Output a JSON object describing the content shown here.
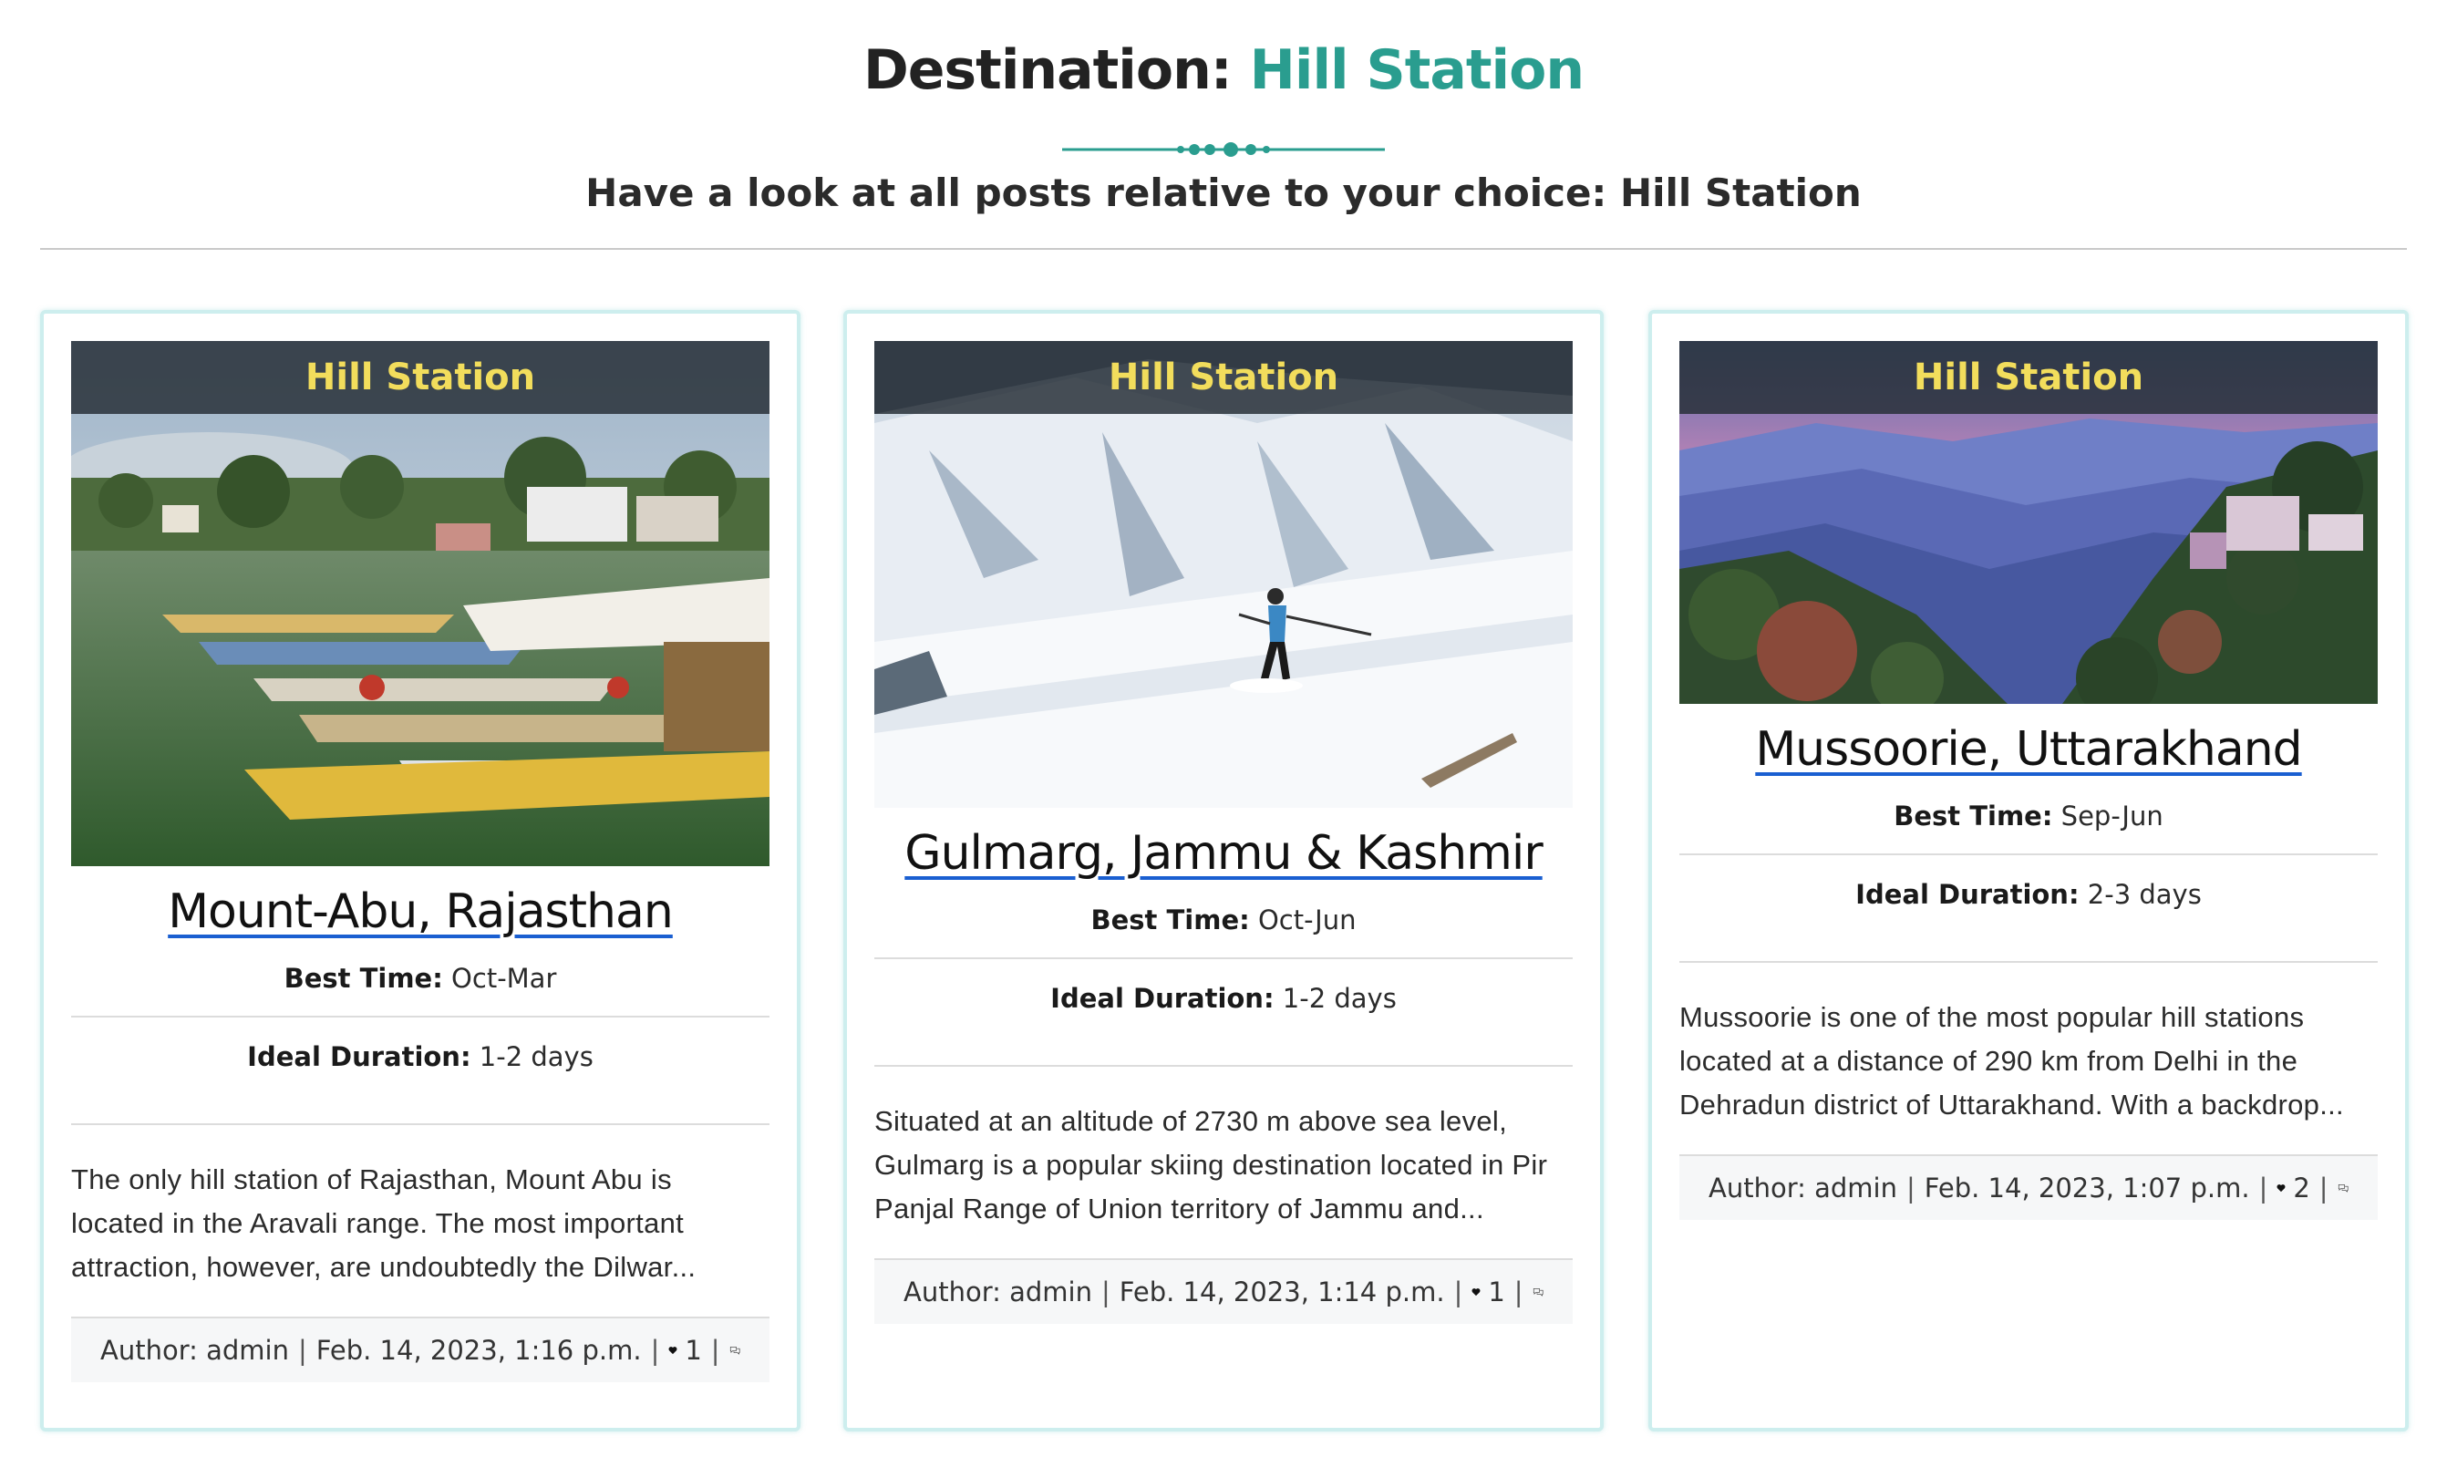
{
  "header": {
    "title_prefix": "Destination:",
    "title_accent": "Hill Station",
    "subtitle": "Have a look at all posts relative to your choice: Hill Station"
  },
  "colors": {
    "accent": "#2a9d8f",
    "banner_text": "#f2dd5c",
    "link_underline": "#1a5fd1"
  },
  "cards": [
    {
      "category": "Hill Station",
      "title": "Mount-Abu, Rajasthan",
      "best_time_label": "Best Time:",
      "best_time": "Oct-Mar",
      "duration_label": "Ideal Duration:",
      "duration": "1-2 days",
      "excerpt": "The only hill station of Rajasthan, Mount Abu is located in the Aravali range. The most important attraction, however, are undoubtedly the Dilwar...",
      "author": "Author: admin",
      "date": "Feb. 14, 2023, 1:16 p.m.",
      "likes": "1",
      "image": "lake-boats-image"
    },
    {
      "category": "Hill Station",
      "title": "Gulmarg, Jammu & Kashmir",
      "best_time_label": "Best Time:",
      "best_time": "Oct-Jun",
      "duration_label": "Ideal Duration:",
      "duration": "1-2 days",
      "excerpt": "Situated at an altitude of 2730 m above sea level, Gulmarg is a popular skiing destination located in Pir Panjal Range of Union territory of Jammu and...",
      "author": "Author: admin",
      "date": "Feb. 14, 2023, 1:14 p.m.",
      "likes": "1",
      "image": "snow-skier-image"
    },
    {
      "category": "Hill Station",
      "title": "Mussoorie, Uttarakhand",
      "best_time_label": "Best Time:",
      "best_time": "Sep-Jun",
      "duration_label": "Ideal Duration:",
      "duration": "2-3 days",
      "excerpt": "Mussoorie is one of the most popular hill stations located at a distance of 290 km from Delhi in the Dehradun district of Uttarakhand. With a backdrop...",
      "author": "Author: admin",
      "date": "Feb. 14, 2023, 1:07 p.m.",
      "likes": "2",
      "image": "mountain-valley-image"
    }
  ]
}
